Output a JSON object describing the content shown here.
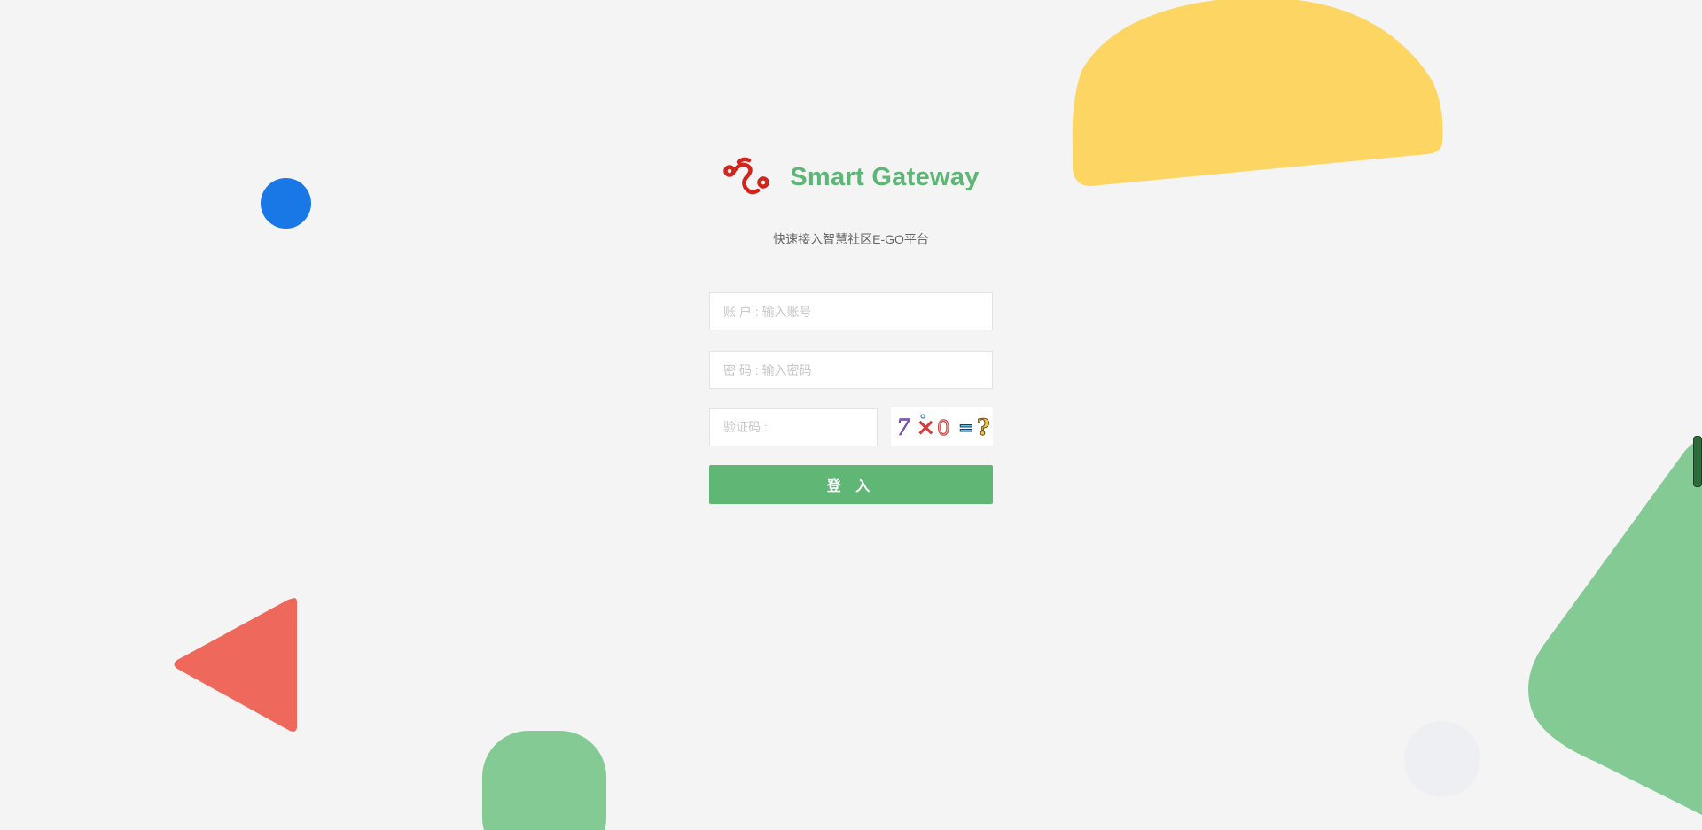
{
  "brand": {
    "name": "Smart Gateway",
    "subtitle": "快速接入智慧社区E-GO平台"
  },
  "form": {
    "account_placeholder": "账 户 : 输入账号",
    "password_placeholder": "密 码 : 输入密码",
    "captcha_placeholder": "验证码 :",
    "captcha_text": "7×0=?",
    "submit_label": "登 入"
  },
  "colors": {
    "brand_green": "#5eb676",
    "button_green": "#60b674",
    "logo_red": "#d0241c",
    "background": "#f4f4f4",
    "decor_yellow": "#fdd562",
    "decor_blue": "#1a78e6",
    "decor_red": "#ee695c",
    "decor_green": "#84ca95"
  }
}
